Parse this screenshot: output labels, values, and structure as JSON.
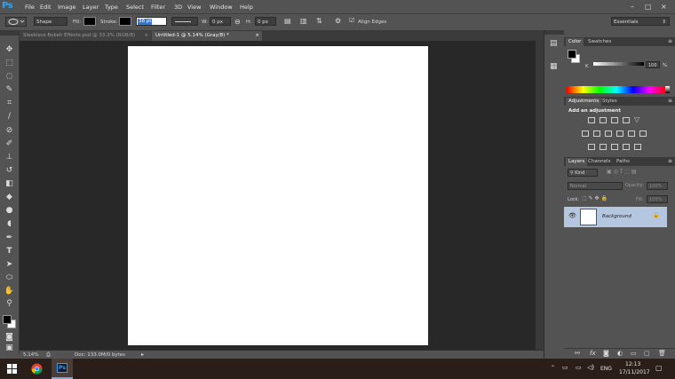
{
  "app": {
    "logo": "Ps",
    "menu": [
      "File",
      "Edit",
      "Image",
      "Layer",
      "Type",
      "Select",
      "Filter",
      "3D",
      "View",
      "Window",
      "Help"
    ],
    "window_controls": [
      "–",
      "□",
      "×"
    ]
  },
  "options": {
    "shape_mode": "Shape",
    "fill_label": "Fill:",
    "stroke_label": "Stroke:",
    "stroke_width": "38 pt",
    "w_label": "W:",
    "w_value": "0 px",
    "h_label": "H:",
    "h_value": "0 px",
    "align_edges": "Align Edges",
    "workspace": "Essentials"
  },
  "tabs": [
    {
      "label": "Sleekless Bokeh Effects.psd @ 33.3% (RGB/8)",
      "close": "×"
    },
    {
      "label": "Untitled-1 @ 5.14% (Gray/8) *",
      "close": "×"
    }
  ],
  "status": {
    "zoom": "5.14%",
    "doc": "Doc: 133.0M/0 bytes"
  },
  "color_panel": {
    "tabs": [
      "Color",
      "Swatches"
    ],
    "channel": "K",
    "value": "100",
    "unit": "%"
  },
  "adjustments_panel": {
    "tabs": [
      "Adjustments",
      "Styles"
    ],
    "heading": "Add an adjustment"
  },
  "layers_panel": {
    "tabs": [
      "Layers",
      "Channels",
      "Paths"
    ],
    "kind": "Kind",
    "blend_mode": "Normal",
    "opacity_label": "Opacity:",
    "opacity_value": "100%",
    "lock_label": "Lock:",
    "fill_label": "Fill:",
    "fill_value": "100%",
    "layer_name": "Background",
    "footer_icons": [
      "link-icon",
      "fx-icon",
      "mask-icon",
      "adjustment-icon",
      "group-icon",
      "new-layer-icon",
      "trash-icon"
    ]
  },
  "taskbar": {
    "language": "ENG",
    "time": "12:13",
    "date": "17/11/2017"
  },
  "colors": {
    "ps_blue": "#2fa3f5",
    "selected_layer": "#b4c6e0",
    "canvas_bg": "#282828",
    "ui_bg": "#535353"
  }
}
